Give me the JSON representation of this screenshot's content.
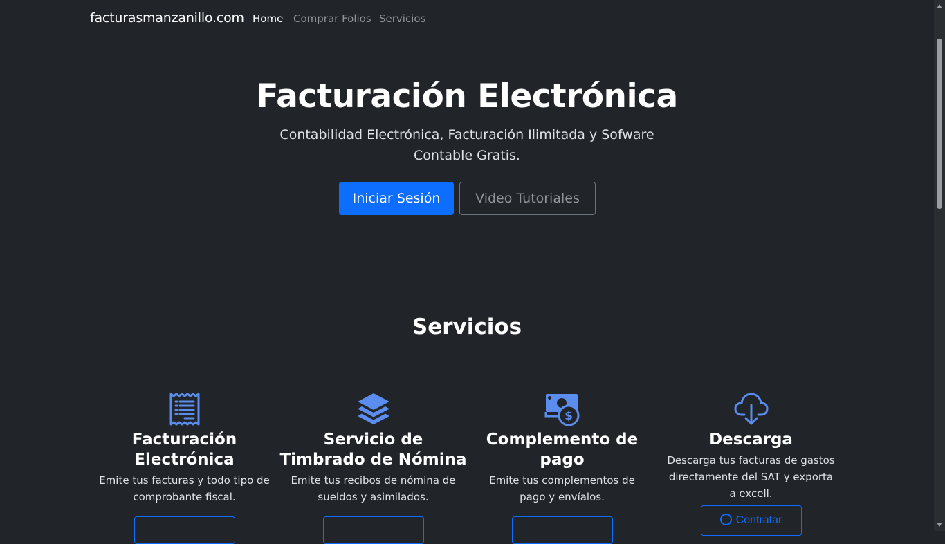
{
  "navbar": {
    "brand": "facturasmanzanillo.com",
    "links": [
      {
        "label": "Home",
        "active": true
      },
      {
        "label": "Comprar Folios",
        "active": false
      },
      {
        "label": "Servicios",
        "active": false
      }
    ]
  },
  "hero": {
    "title": "Facturación Electrónica",
    "subtitle": "Contabilidad Electrónica, Facturación Ilimitada y Sofware Contable Gratis.",
    "primary_button": "Iniciar Sesión",
    "secondary_button": "Video Tutoriales"
  },
  "services": {
    "title": "Servicios",
    "items": [
      {
        "icon": "receipt-icon",
        "title": "Facturación Electrónica",
        "description": "Emite tus facturas y todo tipo de comprobante fiscal.",
        "button": ""
      },
      {
        "icon": "layers-icon",
        "title": "Servicio de Timbrado de Nómina",
        "description": "Emite tus recibos de nómina de sueldos y asimilados.",
        "button": ""
      },
      {
        "icon": "cash-coin-icon",
        "title": "Complemento de pago",
        "description": "Emite tus complementos de pago y envíalos.",
        "button": ""
      },
      {
        "icon": "cloud-download-icon",
        "title": "Descarga",
        "description": "Descarga tus facturas de gastos directamente del SAT y exporta a excell.",
        "button": "Contratar"
      }
    ]
  },
  "colors": {
    "background": "#212529",
    "primary": "#0d6efd",
    "icon": "#5b8def",
    "muted_link": "#8f959b"
  }
}
